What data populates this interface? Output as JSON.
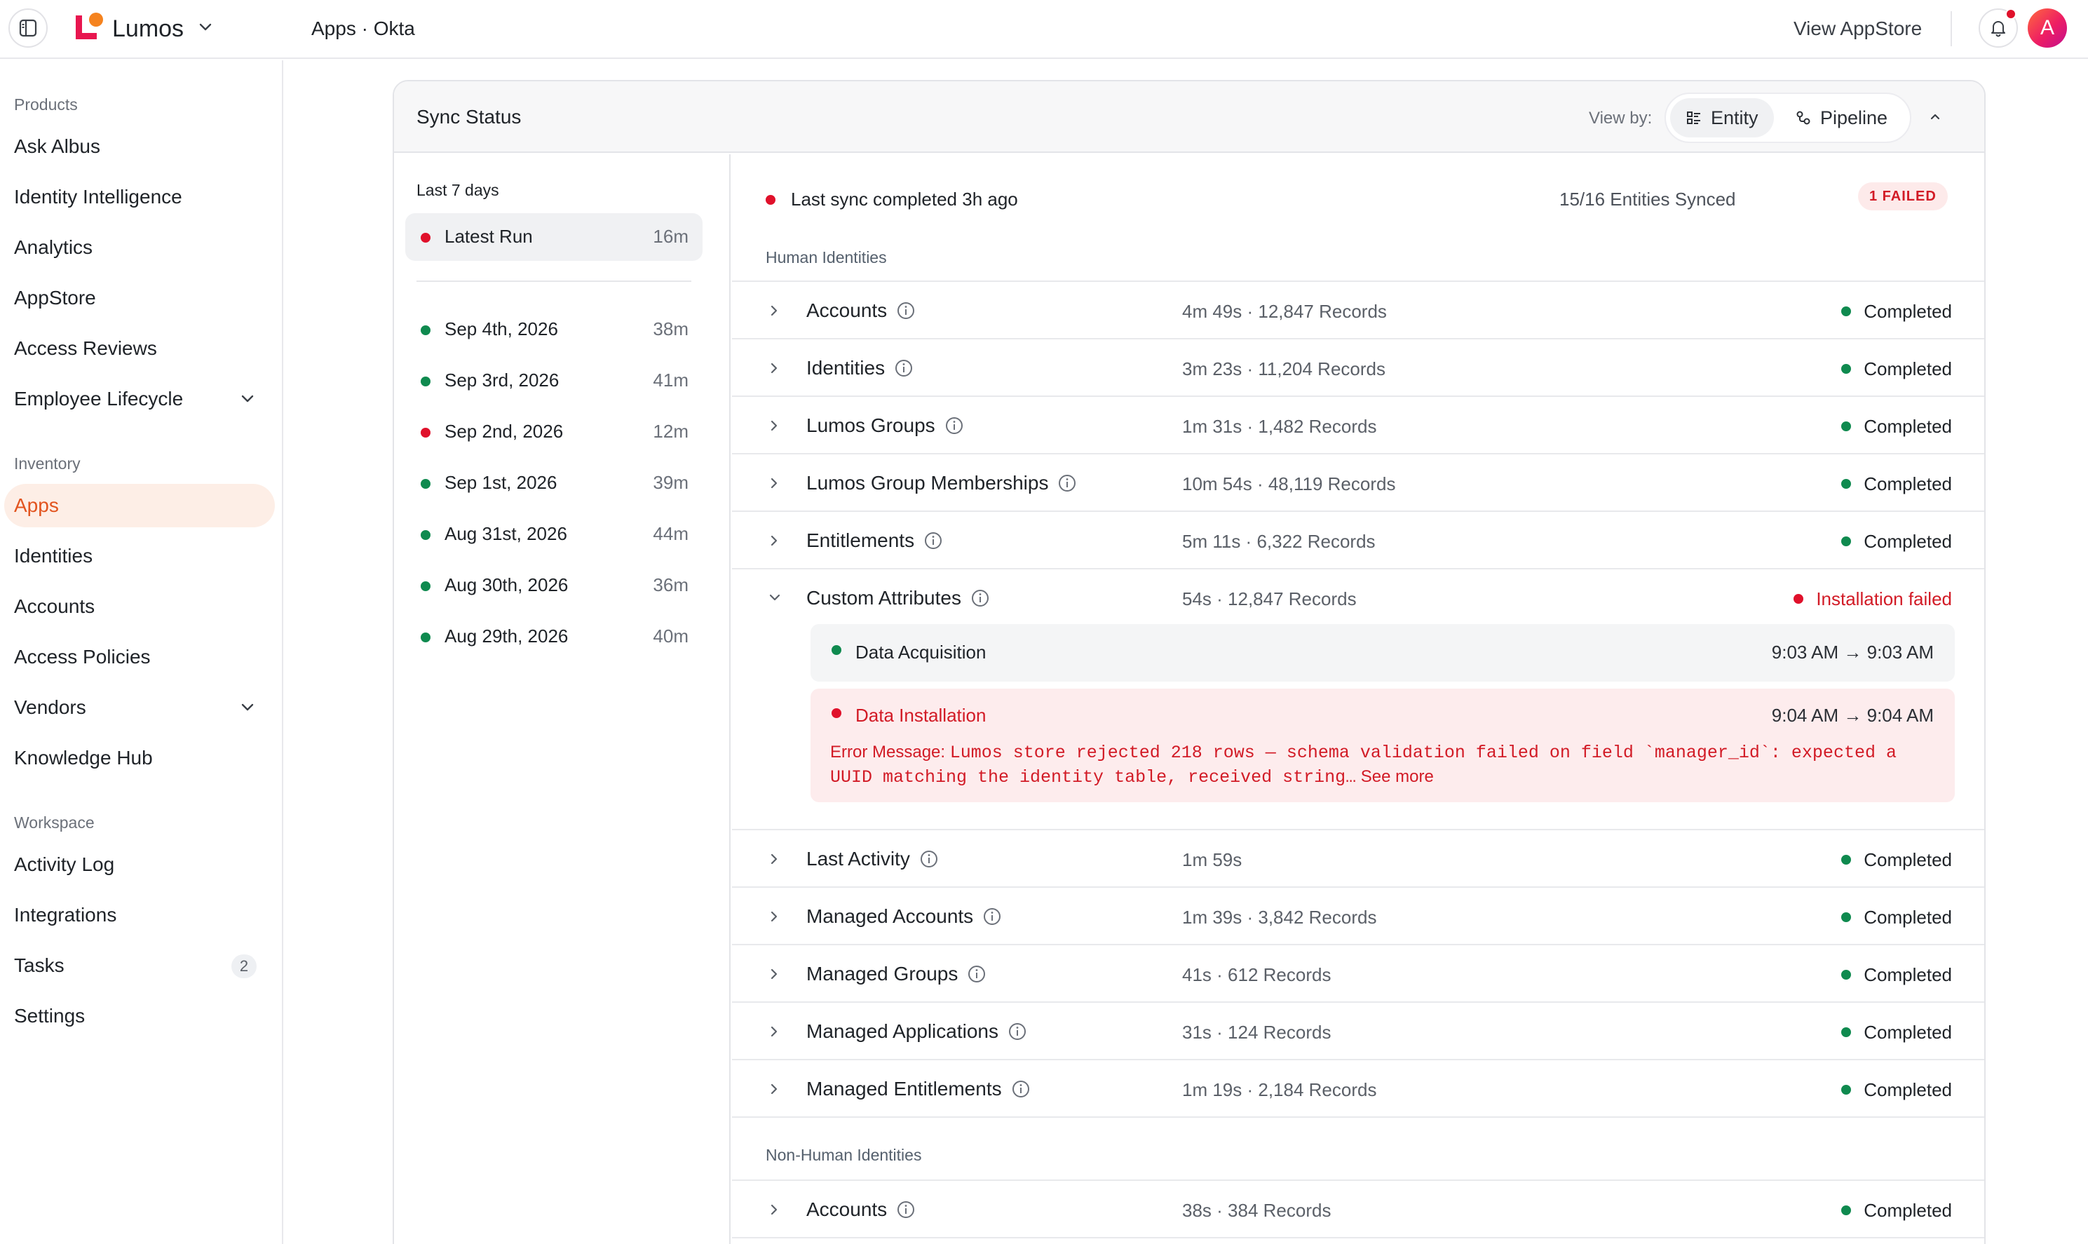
{
  "topbar": {
    "brand": "Lumos",
    "breadcrumb": "Apps · Okta",
    "view_appstore": "View AppStore",
    "avatar_initial": "A"
  },
  "sidebar": {
    "products_label": "Products",
    "products": [
      {
        "label": "Ask Albus"
      },
      {
        "label": "Identity Intelligence"
      },
      {
        "label": "Analytics"
      },
      {
        "label": "AppStore"
      },
      {
        "label": "Access Reviews"
      },
      {
        "label": "Employee Lifecycle"
      }
    ],
    "inventory_label": "Inventory",
    "inventory": [
      {
        "label": "Apps"
      },
      {
        "label": "Identities"
      },
      {
        "label": "Accounts"
      },
      {
        "label": "Access Policies"
      },
      {
        "label": "Vendors"
      },
      {
        "label": "Knowledge Hub"
      }
    ],
    "workspace_label": "Workspace",
    "workspace": [
      {
        "label": "Activity Log"
      },
      {
        "label": "Integrations"
      },
      {
        "label": "Tasks",
        "badge": "2"
      },
      {
        "label": "Settings"
      }
    ]
  },
  "sync": {
    "title": "Sync Status",
    "view_by_label": "View by:",
    "view_options": [
      "Entity",
      "Pipeline"
    ],
    "selected_view": "Entity",
    "range_label": "Last 7 days",
    "runs": [
      {
        "label": "Latest Run",
        "duration": "16m",
        "status": "failed"
      },
      {
        "label": "Sep 4th, 2026",
        "duration": "38m",
        "status": "ok"
      },
      {
        "label": "Sep 3rd, 2026",
        "duration": "41m",
        "status": "ok"
      },
      {
        "label": "Sep 2nd, 2026",
        "duration": "12m",
        "status": "failed"
      },
      {
        "label": "Sep 1st, 2026",
        "duration": "39m",
        "status": "ok"
      },
      {
        "label": "Aug 31st, 2026",
        "duration": "44m",
        "status": "ok"
      },
      {
        "label": "Aug 30th, 2026",
        "duration": "36m",
        "status": "ok"
      },
      {
        "label": "Aug 29th, 2026",
        "duration": "40m",
        "status": "ok"
      }
    ],
    "summary": "Last sync completed 3h ago",
    "entities_synced": "15/16 Entities Synced",
    "failed_badge": "1 FAILED",
    "human_label": "Human Identities",
    "human": [
      {
        "name": "Accounts",
        "meta": "4m 49s · 12,847 Records",
        "status": "Completed"
      },
      {
        "name": "Identities",
        "meta": "3m 23s · 11,204 Records",
        "status": "Completed"
      },
      {
        "name": "Lumos Groups",
        "meta": "1m 31s · 1,482 Records",
        "status": "Completed"
      },
      {
        "name": "Lumos Group Memberships",
        "meta": "10m 54s · 48,119 Records",
        "status": "Completed"
      },
      {
        "name": "Entitlements",
        "meta": "5m 11s · 6,322 Records",
        "status": "Completed"
      },
      {
        "name": "Custom Attributes",
        "meta": "54s · 12,847 Records",
        "status": "Installation failed"
      },
      {
        "name": "Last Activity",
        "meta": "1m 59s",
        "status": "Completed"
      },
      {
        "name": "Managed Accounts",
        "meta": "1m 39s · 3,842 Records",
        "status": "Completed"
      },
      {
        "name": "Managed Groups",
        "meta": "41s · 612 Records",
        "status": "Completed"
      },
      {
        "name": "Managed Applications",
        "meta": "31s · 124 Records",
        "status": "Completed"
      },
      {
        "name": "Managed Entitlements",
        "meta": "1m 19s · 2,184 Records",
        "status": "Completed"
      }
    ],
    "expanded": {
      "acquisition_label": "Data Acquisition",
      "acquisition_time": "9:03 AM → 9:03 AM",
      "installation_label": "Data Installation",
      "installation_time": "9:04 AM → 9:04 AM",
      "error_label": "Error Message:",
      "error_body": "Lumos store rejected 218 rows — schema validation failed on field `manager_id`: expected a UUID matching the identity table, received string…",
      "see_more": "See more"
    },
    "nonhuman_label": "Non-Human Identities",
    "nonhuman": [
      {
        "name": "Accounts",
        "meta": "38s · 384 Records",
        "status": "Completed"
      }
    ]
  },
  "colors": {
    "accent": "#e2541f",
    "success": "#0f8a4f",
    "danger": "#e0112b"
  }
}
